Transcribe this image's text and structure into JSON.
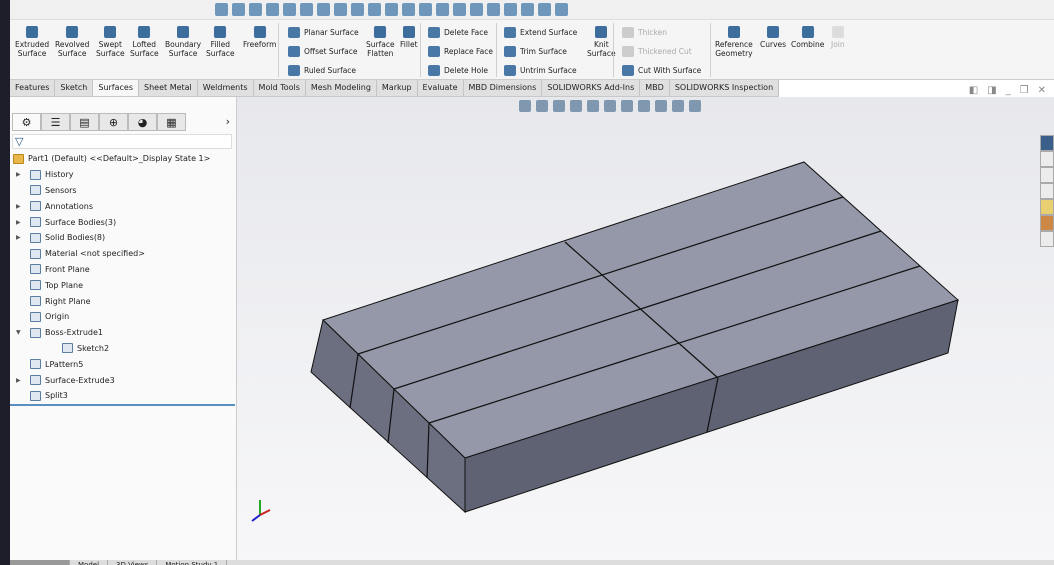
{
  "ribbon": {
    "big": [
      {
        "label": "Extruded\nSurface"
      },
      {
        "label": "Revolved\nSurface"
      },
      {
        "label": "Swept\nSurface"
      },
      {
        "label": "Lofted\nSurface"
      },
      {
        "label": "Boundary\nSurface"
      },
      {
        "label": "Filled\nSurface"
      },
      {
        "label": "Freeform"
      }
    ],
    "planar": "Planar Surface",
    "offset": "Offset Surface",
    "ruled": "Ruled Surface",
    "flatten": "Surface\nFlatten",
    "fillet": "Fillet",
    "delete_face": "Delete Face",
    "replace_face": "Replace Face",
    "delete_hole": "Delete Hole",
    "extend": "Extend Surface",
    "trim": "Trim Surface",
    "untrim": "Untrim Surface",
    "knit": "Knit\nSurface",
    "thicken": "Thicken",
    "thickened_cut": "Thickened Cut",
    "cut_with": "Cut With Surface",
    "refgeom": "Reference\nGeometry",
    "curves": "Curves",
    "combine": "Combine",
    "join": "Join"
  },
  "tabs": [
    "Features",
    "Sketch",
    "Surfaces",
    "Sheet Metal",
    "Weldments",
    "Mold Tools",
    "Mesh Modeling",
    "Markup",
    "Evaluate",
    "MBD Dimensions",
    "SOLIDWORKS Add-Ins",
    "MBD",
    "SOLIDWORKS Inspection"
  ],
  "active_tab": "Surfaces",
  "tree": {
    "root": "Part1 (Default) <<Default>_Display State 1>",
    "items": [
      {
        "label": "History",
        "expand": true
      },
      {
        "label": "Sensors",
        "expand": false
      },
      {
        "label": "Annotations",
        "expand": true
      },
      {
        "label": "Surface Bodies(3)",
        "expand": true
      },
      {
        "label": "Solid Bodies(8)",
        "expand": true
      },
      {
        "label": "Material <not specified>",
        "expand": false
      },
      {
        "label": "Front Plane",
        "expand": false
      },
      {
        "label": "Top Plane",
        "expand": false
      },
      {
        "label": "Right Plane",
        "expand": false
      },
      {
        "label": "Origin",
        "expand": false
      },
      {
        "label": "Boss-Extrude1",
        "expand": "open"
      },
      {
        "label": "Sketch2",
        "expand": false,
        "indent": true
      },
      {
        "label": "LPattern5",
        "expand": false
      },
      {
        "label": "Surface-Extrude3",
        "expand": true
      },
      {
        "label": "Split3",
        "expand": false
      }
    ]
  },
  "bottom_tabs": [
    "",
    "Model",
    "3D Views",
    "Motion Study 1"
  ],
  "colors": {
    "top_face": "#9598a8",
    "left_face": "#6c6f80",
    "front_face": "#5f6272",
    "edge": "#111111"
  }
}
